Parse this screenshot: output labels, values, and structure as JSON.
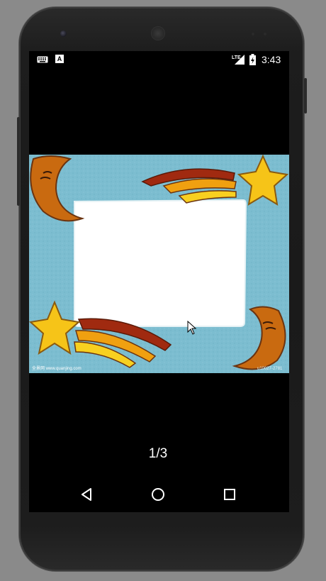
{
  "status_bar": {
    "time": "3:43",
    "network_label": "LTE",
    "notification_icons": [
      "keyboard-icon",
      "a-letter-icon"
    ],
    "a_icon_label": "A"
  },
  "image_viewer": {
    "watermark_left": "全景网 www.quanjing.com",
    "watermark_right": "u10027-2781",
    "frame_background": "#7cbdd0"
  },
  "pager": {
    "counter": "1/3"
  },
  "nav_bar": {
    "buttons": [
      "back-icon",
      "home-icon",
      "recents-icon"
    ]
  }
}
